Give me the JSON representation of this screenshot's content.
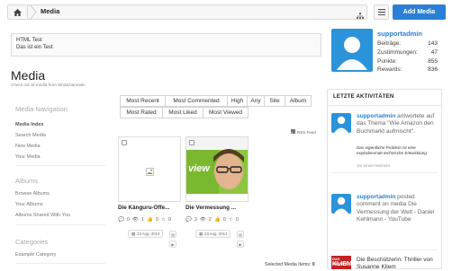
{
  "breadcrumb": {
    "current": "Media"
  },
  "header": {
    "add_media_label": "Add Media"
  },
  "testbox": {
    "line1": "HTML Test",
    "line2": "Das ist ein Test"
  },
  "page": {
    "title": "Media",
    "subtitle": "Check out all media from Whatchareadin"
  },
  "nav": {
    "media_heading": "Media Navigation",
    "media_items": [
      "Media Index",
      "Search Media",
      "New Media",
      "Your Media"
    ],
    "albums_heading": "Albums",
    "album_items": [
      "Browse Albums",
      "Your Albums",
      "Albums Shared With You"
    ],
    "categories_heading": "Categories",
    "category_items": [
      "Example Category"
    ]
  },
  "tabs": {
    "row1": [
      "Most Recent",
      "Most Commented",
      "High",
      "Any",
      "Site",
      "Album"
    ],
    "row2": [
      "Most Rated",
      "Most Liked",
      "Most Viewed"
    ]
  },
  "rss_label": "RSS Feed",
  "media": [
    {
      "title": "Die Känguru-Offe...",
      "comments": "0",
      "views": "1",
      "likes": "0",
      "rating": "0",
      "date": "23 Aug. 2014"
    },
    {
      "title": "Die Vermessung ...",
      "comments": "3",
      "views": "2",
      "likes": "0",
      "rating": "0",
      "date": "23 Aug. 2014",
      "image_text": "view"
    }
  ],
  "selected_label": "Selected Media Items:",
  "selected_count": "0",
  "profile": {
    "username": "supportadmin",
    "stats": [
      {
        "label": "Beiträge:",
        "value": "143"
      },
      {
        "label": "Zustimmungen:",
        "value": "47"
      },
      {
        "label": "Punkte:",
        "value": "855"
      },
      {
        "label": "Rewards:",
        "value": "836"
      }
    ]
  },
  "activity": {
    "heading": "LETZTE AKTIVITÄTEN",
    "item1": {
      "user": "supportadmin",
      "text": "antwortete auf das Thema \"Wie Amazon den Buchmarkt aufmischt\".",
      "snippet": "Das eigentliche Problem ist eine explodierende technische Entwicklung",
      "time": "Vor einem Moment"
    },
    "item2": {
      "user": "supportadmin",
      "text": "posted comment on media Die Vermessung der Welt - Daniel Kehlmann - YouTube",
      "time": "Vor einem Moment"
    },
    "item3": {
      "logo_top": "DAS KANNTE",
      "logo_main": "KLIEM",
      "title": "Die Beschützerin: Thriller von Susanne Kliem"
    }
  },
  "colors": {
    "accent": "#2b7fd4",
    "avatar_bg": "#2b93d9",
    "logo_red": "#c32222"
  }
}
